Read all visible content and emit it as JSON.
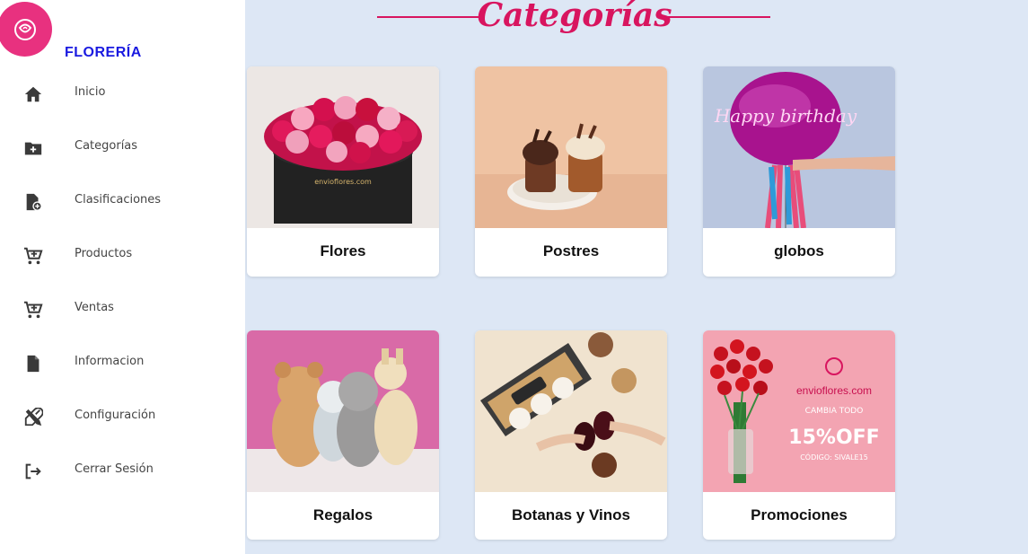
{
  "sidebar": {
    "brand": "FLORERÍA",
    "logo_icon": "rose-icon",
    "items": [
      {
        "label": "Inicio",
        "icon": "home-icon"
      },
      {
        "label": "Categorías",
        "icon": "folder-plus-icon"
      },
      {
        "label": "Clasificaciones",
        "icon": "file-plus-icon"
      },
      {
        "label": "Productos",
        "icon": "cart-plus-icon"
      },
      {
        "label": "Ventas",
        "icon": "cart-plus-icon"
      },
      {
        "label": "Informacion",
        "icon": "file-icon"
      },
      {
        "label": "Configuración",
        "icon": "tools-icon"
      },
      {
        "label": "Cerrar Sesión",
        "icon": "logout-icon"
      }
    ]
  },
  "main": {
    "title": "Categorías",
    "categories": [
      {
        "label": "Flores",
        "image": "flowers-box-image",
        "image_text": "envioflores.com"
      },
      {
        "label": "Postres",
        "image": "desserts-image"
      },
      {
        "label": "globos",
        "image": "balloon-image",
        "image_text": "Happy birthday"
      },
      {
        "label": "Regalos",
        "image": "plush-toys-image"
      },
      {
        "label": "Botanas y Vinos",
        "image": "wine-snacks-image"
      },
      {
        "label": "Promociones",
        "image": "promo-banner-image",
        "promo": {
          "brand": "envioflores.com",
          "line1": "CAMBIA TODO",
          "discount": "15%OFF",
          "code": "CÓDIGO: SIVALE15"
        }
      }
    ]
  },
  "colors": {
    "accent": "#d8155f",
    "logo_bg": "#e8317f",
    "brand_text": "#1a1ae0",
    "background": "#dde7f5"
  }
}
